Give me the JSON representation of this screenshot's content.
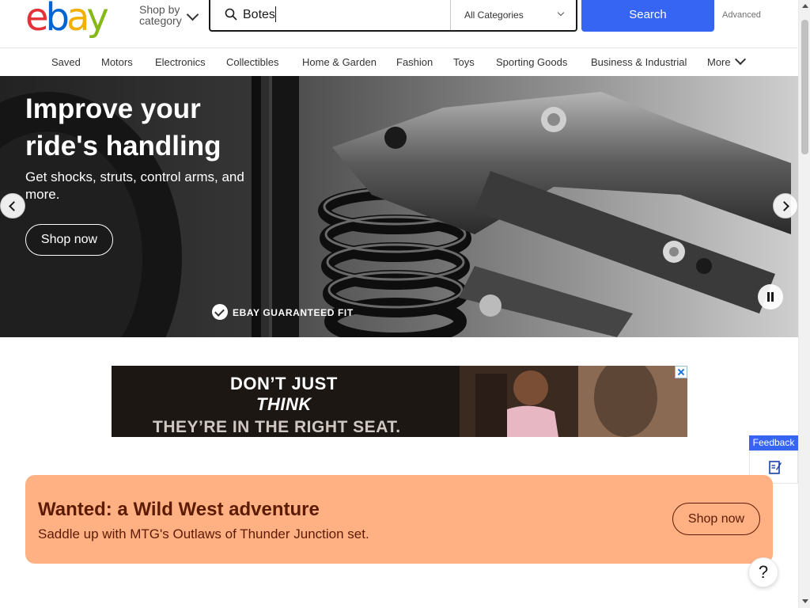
{
  "header": {
    "logo": {
      "e": "e",
      "b": "b",
      "a": "a",
      "y": "y"
    },
    "shop_by_line1": "Shop by",
    "shop_by_line2": "category",
    "search_value": "Botes",
    "category_select": "All Categories",
    "search_button": "Search",
    "advanced_link": "Advanced"
  },
  "nav": {
    "items": [
      "Saved",
      "Motors",
      "Electronics",
      "Collectibles",
      "Home & Garden",
      "Fashion",
      "Toys",
      "Sporting Goods",
      "Business & Industrial",
      "More"
    ]
  },
  "hero": {
    "title": "Improve your ride's handling",
    "subtitle": "Get shocks, struts, control arms, and more.",
    "button": "Shop now",
    "badge": "EBAY GUARANTEED FIT"
  },
  "ad": {
    "line1": "DON’T JUST",
    "line2": "THINK",
    "line3": "THEY’RE IN THE RIGHT SEAT."
  },
  "feedback": {
    "label": "Feedback"
  },
  "promo": {
    "title": "Wanted: a Wild West adventure",
    "subtitle": "Saddle up with MTG's Outlaws of Thunder Junction set.",
    "button": "Shop now"
  },
  "help": {
    "label": "?"
  },
  "colors": {
    "search_button": "#3665f3",
    "promo_bg": "#ffb183",
    "promo_text": "#5c1b05"
  },
  "icons": [
    "search-icon",
    "chevron-down-icon",
    "chevron-left-icon",
    "chevron-right-icon",
    "pause-icon",
    "check-icon",
    "close-icon",
    "feedback-edit-icon",
    "help-icon"
  ]
}
